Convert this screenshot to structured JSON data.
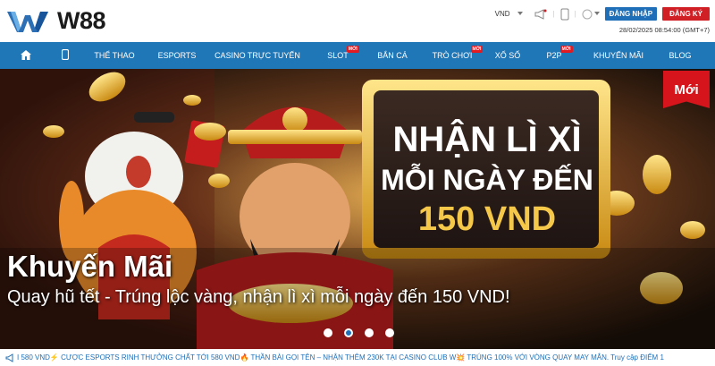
{
  "header": {
    "brand": "W88",
    "currency": "VND",
    "login_label": "ĐĂNG NHẬP",
    "register_label": "ĐĂNG KÝ",
    "datetime": "28/02/2025 08:54:00 (GMT+7)"
  },
  "nav": {
    "items": [
      {
        "label": "THỂ THAO"
      },
      {
        "label": "ESPORTS"
      },
      {
        "label": "CASINO TRỰC TUYẾN"
      },
      {
        "label": "SLOT",
        "badge": "MỚI"
      },
      {
        "label": "BẮN CÁ"
      },
      {
        "label": "TRÒ CHƠI",
        "badge": "MỚI"
      },
      {
        "label": "XỔ SỐ"
      },
      {
        "label": "P2P",
        "badge": "MỚI"
      },
      {
        "label": "KHUYẾN MÃI"
      },
      {
        "label": "BLOG"
      }
    ]
  },
  "banner": {
    "new_tag": "Mới",
    "headline_line1": "NHẬN LÌ XÌ",
    "headline_line2": "MỖI NGÀY ĐẾN",
    "headline_line3": "150 VND",
    "title": "Khuyến Mãi",
    "subtitle": "Quay hũ tết - Trúng lộc vàng, nhận lì xì mỗi ngày đến 150 VND!",
    "active_slide": 2,
    "slide_count": 4
  },
  "ticker": {
    "text": "I 580 VND⚡ CƯỢC ESPORTS RINH THƯỞNG CHẤT TỚI 580 VND🔥 THẦN BÀI GỌI TÊN – NHẬN THÊM 230K TẠI CASINO CLUB W💥 TRÚNG 100% VỚI VÒNG QUAY MAY MẮN. Truy cập ĐIỂM 1"
  },
  "colors": {
    "nav_bg": "#1f77b8",
    "login_bg": "#1e6fb7",
    "register_bg": "#d11f26",
    "badge": "#e21b23"
  }
}
